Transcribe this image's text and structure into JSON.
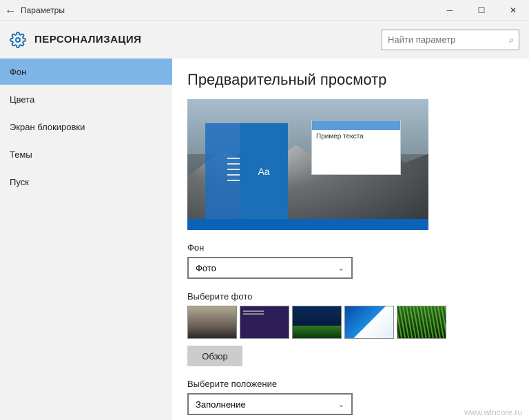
{
  "window": {
    "title": "Параметры"
  },
  "header": {
    "title": "ПЕРСОНАЛИЗАЦИЯ",
    "search_placeholder": "Найти параметр"
  },
  "sidebar": {
    "items": [
      {
        "label": "Фон",
        "active": true
      },
      {
        "label": "Цвета"
      },
      {
        "label": "Экран блокировки"
      },
      {
        "label": "Темы"
      },
      {
        "label": "Пуск"
      }
    ]
  },
  "main": {
    "preview_heading": "Предварительный просмотр",
    "preview_tile_text": "Aa",
    "preview_sample_text": "Пример текста",
    "background_label": "Фон",
    "background_value": "Фото",
    "choose_photo_label": "Выберите фото",
    "browse_button": "Обзор",
    "fit_label": "Выберите положение",
    "fit_value": "Заполнение"
  },
  "watermark": "www.wincore.ru"
}
